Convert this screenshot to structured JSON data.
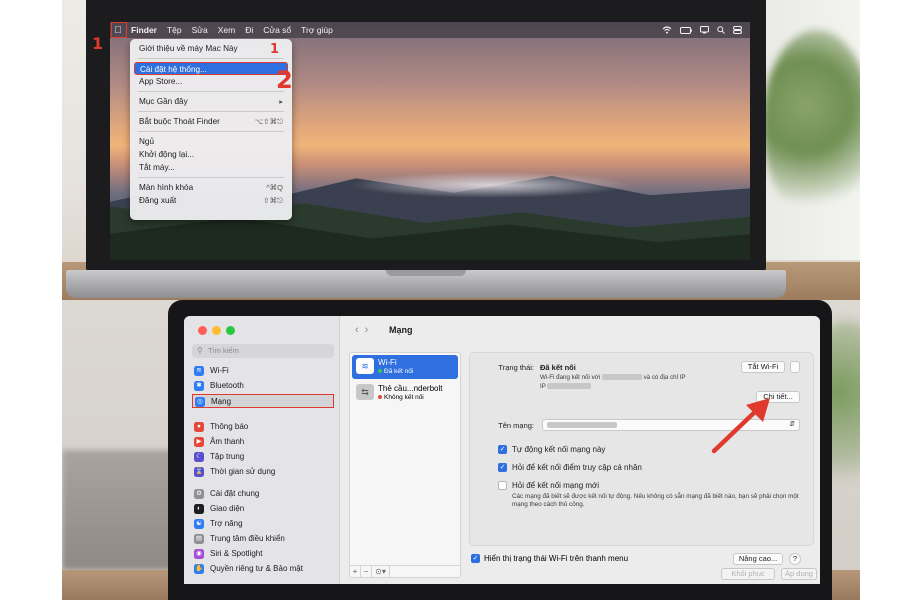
{
  "step_markers": {
    "one": "1",
    "one_b": "1",
    "two": "2"
  },
  "menubar": {
    "apple_icon": "apple-logo",
    "items": [
      "Finder",
      "Tệp",
      "Sửa",
      "Xem",
      "Đi",
      "Cửa sổ",
      "Trợ giúp"
    ],
    "status_icons": [
      "wifi-icon",
      "battery-icon",
      "display-icon",
      "search-icon",
      "control-center-icon"
    ]
  },
  "apple_menu": {
    "about": "Giới thiệu về máy Mac Này",
    "system_settings": "Cài đặt hệ thống...",
    "app_store": "App Store...",
    "recent_items": "Mục Gần đây",
    "force_quit": "Bắt buộc Thoát Finder",
    "force_quit_shortcut": "⌥⇧⌘⎋",
    "sleep": "Ngủ",
    "restart": "Khởi động lại...",
    "shutdown": "Tắt máy...",
    "lock_screen": "Màn hình khóa",
    "lock_screen_shortcut": "^⌘Q",
    "logout": "Đăng xuất",
    "logout_shortcut": "⇧⌘⎋"
  },
  "settings": {
    "search_placeholder": "Tìm kiếm",
    "sidebar": [
      {
        "label": "Wi-Fi",
        "icon": "wifi-icon",
        "color": "#2f7cf6"
      },
      {
        "label": "Bluetooth",
        "icon": "bluetooth-icon",
        "color": "#2f7cf6"
      },
      {
        "label": "Mạng",
        "icon": "globe-icon",
        "color": "#2f7cf6"
      },
      {
        "label": "Thông báo",
        "icon": "bell-icon",
        "color": "#e5473b"
      },
      {
        "label": "Âm thanh",
        "icon": "speaker-icon",
        "color": "#e5473b"
      },
      {
        "label": "Tập trung",
        "icon": "moon-icon",
        "color": "#5a4fcf"
      },
      {
        "label": "Thời gian sử dụng",
        "icon": "hourglass-icon",
        "color": "#5a4fcf"
      },
      {
        "label": "Cài đặt chung",
        "icon": "gear-icon",
        "color": "#8e8e93"
      },
      {
        "label": "Giao diện",
        "icon": "appearance-icon",
        "color": "#1d1d1f"
      },
      {
        "label": "Trợ năng",
        "icon": "accessibility-icon",
        "color": "#2f7cf6"
      },
      {
        "label": "Trung tâm điều khiển",
        "icon": "control-center-icon",
        "color": "#8e8e93"
      },
      {
        "label": "Siri & Spotlight",
        "icon": "siri-icon",
        "color": "#a64bd8"
      },
      {
        "label": "Quyền riêng tư & Bảo mật",
        "icon": "hand-icon",
        "color": "#2f7cf6"
      }
    ],
    "page_title": "Mạng",
    "services": [
      {
        "name": "Wi-Fi",
        "status": "Đã kết nối",
        "status_color": "#34c759"
      },
      {
        "name": "Thẻ cầu...nderbolt",
        "status": "Không kết nối",
        "status_color": "#e5473b"
      }
    ],
    "list_footer": [
      "+",
      "−",
      "⊙▾"
    ],
    "status_label": "Trạng thái:",
    "status_value": "Đã kết nối",
    "status_detail_a": "Wi-Fi đang kết nối với",
    "status_detail_b": "và có địa chỉ IP",
    "status_detail_c": "IP",
    "turn_off_wifi": "Tắt Wi-Fi",
    "details_button": "Chi tiết...",
    "network_name_label": "Tên mạng:",
    "options": [
      {
        "label": "Tự động kết nối mạng này",
        "checked": true
      },
      {
        "label": "Hỏi để kết nối điểm truy cập cá nhân",
        "checked": true
      },
      {
        "label": "Hỏi để kết nối mạng mới",
        "checked": false
      }
    ],
    "note": "Các mạng đã biết sẽ được kết nối tự động. Nếu không có sẵn mạng đã biết nào, bạn sẽ phải chọn một mạng theo cách thủ công.",
    "show_wifi_status": "Hiển thị trạng thái Wi-Fi trên thanh menu",
    "advanced": "Nâng cao...",
    "help": "?",
    "revert": "Khôi phục",
    "apply": "Áp dụng"
  }
}
